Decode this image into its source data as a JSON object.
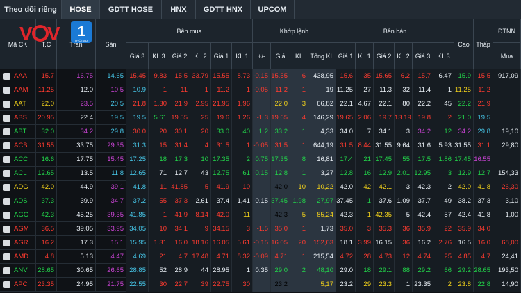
{
  "tabs": [
    "Theo dõi riêng",
    "HOSE",
    "GDTT HOSE",
    "HNX",
    "GDTT HNX",
    "UPCOM"
  ],
  "active_tab": "HOSE",
  "logo": {
    "text": "VOV",
    "badge": "1",
    "badge_sub": "THỜI SỰ"
  },
  "header": {
    "ma_ck": "Mã CK",
    "tc": "T.C",
    "tran": "Trần",
    "san": "Sàn",
    "ben_mua": "Bên mua",
    "khop_lenh": "Khớp lệnh",
    "ben_ban": "Bên bán",
    "cao": "Cao",
    "thap": "Thấp",
    "dtnn": "ĐTNN",
    "mua": "Mua",
    "gia3": "Giá 3",
    "kl3": "KL 3",
    "gia2": "Giá 2",
    "kl2": "KL 2",
    "gia1": "Giá 1",
    "kl1": "KL 1",
    "plusminus": "+/-",
    "gia": "Giá",
    "kl": "KL",
    "tong_kl": "Tổng KL"
  },
  "rows": [
    [
      "AAA",
      "15.7",
      "16.75",
      "14.65",
      "15.45",
      "9.83",
      "15.5",
      "33.79",
      "15.55",
      "8.73",
      "-0.15",
      "15.55",
      "6",
      "438,95",
      "15.6",
      "35",
      "15.65",
      "6.2",
      "15.7",
      "6.47",
      "15.9",
      "15.5",
      "917,09"
    ],
    [
      "AAM",
      "11.25",
      "12.0",
      "10.5",
      "10.9",
      "1",
      "11",
      "1",
      "11.2",
      "1",
      "-0.05",
      "11.2",
      "1",
      "19",
      "11.25",
      "27",
      "11.3",
      "32",
      "11.4",
      "1",
      "11.25",
      "11.2",
      ""
    ],
    [
      "AAT",
      "22.0",
      "23.5",
      "20.5",
      "21.8",
      "1.30",
      "21.9",
      "2.95",
      "21.95",
      "1.96",
      "",
      "22.0",
      "3",
      "66,82",
      "22.1",
      "4.67",
      "22.1",
      "80",
      "22.2",
      "45",
      "22.2",
      "21.9",
      ""
    ],
    [
      "ABS",
      "20.95",
      "22.4",
      "19.5",
      "19.5",
      "5.61",
      "19.55",
      "25",
      "19.6",
      "1.26",
      "-1.3",
      "19.65",
      "4",
      "146,29",
      "19.65",
      "2.06",
      "19.7",
      "13.19",
      "19.8",
      "2",
      "21.0",
      "19.5",
      ""
    ],
    [
      "ABT",
      "32.0",
      "34.2",
      "29.8",
      "30.0",
      "20",
      "30.1",
      "20",
      "33.0",
      "40",
      "1.2",
      "33.2",
      "1",
      "4,33",
      "34.0",
      "7",
      "34.1",
      "3",
      "34.2",
      "12",
      "34.2",
      "29.8",
      "19,10"
    ],
    [
      "ACB",
      "31.55",
      "33.75",
      "29.35",
      "31.3",
      "15",
      "31.4",
      "4",
      "31.5",
      "1",
      "-0.05",
      "31.5",
      "1",
      "644,19",
      "31.5",
      "8.44",
      "31.55",
      "9.64",
      "31.6",
      "5.93",
      "31.55",
      "31.1",
      "29,80"
    ],
    [
      "ACC",
      "16.6",
      "17.75",
      "15.45",
      "17.25",
      "18",
      "17.3",
      "10",
      "17.35",
      "2",
      "0.75",
      "17.35",
      "8",
      "16,81",
      "17.4",
      "21",
      "17.45",
      "55",
      "17.5",
      "1.86",
      "17.45",
      "16.55",
      ""
    ],
    [
      "ACL",
      "12.65",
      "13.5",
      "11.8",
      "12.65",
      "71",
      "12.7",
      "43",
      "12.75",
      "61",
      "0.15",
      "12.8",
      "1",
      "3,27",
      "12.8",
      "16",
      "12.9",
      "2.01",
      "12.95",
      "3",
      "12.9",
      "12.7",
      "154,33"
    ],
    [
      "ADG",
      "42.0",
      "44.9",
      "39.1",
      "41.8",
      "11",
      "41.85",
      "5",
      "41.9",
      "10",
      "",
      "42.0",
      "10",
      "10,22",
      "42.0",
      "42",
      "42.1",
      "3",
      "42.3",
      "2",
      "42.0",
      "41.8",
      "26,30"
    ],
    [
      "ADS",
      "37.3",
      "39.9",
      "34.7",
      "37.2",
      "55",
      "37.3",
      "2,61",
      "37.4",
      "1,41",
      "0.15",
      "37.45",
      "1.98",
      "27,97",
      "37.45",
      "1",
      "37.6",
      "1.09",
      "37.7",
      "49",
      "38.2",
      "37.3",
      "3,10"
    ],
    [
      "AGG",
      "42.3",
      "45.25",
      "39.35",
      "41.85",
      "1",
      "41.9",
      "8.14",
      "42.0",
      "11",
      "",
      "42.3",
      "5",
      "85,24",
      "42.3",
      "1",
      "42.35",
      "5",
      "42.4",
      "57",
      "42.4",
      "41.8",
      "1,00"
    ],
    [
      "AGM",
      "36.5",
      "39.05",
      "33.95",
      "34.05",
      "10",
      "34.1",
      "9",
      "34.15",
      "3",
      "-1.5",
      "35.0",
      "1",
      "1,73",
      "35.0",
      "3",
      "35.3",
      "36",
      "35.9",
      "22",
      "35.9",
      "34.0",
      ""
    ],
    [
      "AGR",
      "16.2",
      "17.3",
      "15.1",
      "15.95",
      "1.31",
      "16.0",
      "18.16",
      "16.05",
      "5.61",
      "-0.15",
      "16.05",
      "20",
      "152,63",
      "18.1",
      "3.99",
      "16.15",
      "36",
      "16.2",
      "2.76",
      "16.5",
      "16.0",
      "68,00"
    ],
    [
      "AMD",
      "4.8",
      "5.13",
      "4.47",
      "4.69",
      "21",
      "4.7",
      "17.48",
      "4.71",
      "8.32",
      "-0.09",
      "4.71",
      "1",
      "215,54",
      "4.72",
      "28",
      "4.73",
      "12",
      "4.74",
      "25",
      "4.85",
      "4.7",
      "24,41"
    ],
    [
      "ANV",
      "28.65",
      "30.65",
      "26.65",
      "28.85",
      "52",
      "28.9",
      "44",
      "28.95",
      "1",
      "0.35",
      "29.0",
      "2",
      "48,10",
      "29.0",
      "18",
      "29.1",
      "88",
      "29.2",
      "66",
      "29.2",
      "28.65",
      "193,50"
    ],
    [
      "APC",
      "23.35",
      "24.95",
      "21.75",
      "22.55",
      "30",
      "22.7",
      "39",
      "22.75",
      "30",
      "",
      "23.2",
      "",
      "5,17",
      "23.2",
      "29",
      "23.3",
      "1",
      "23.35",
      "2",
      "23.8",
      "22.8",
      "14,90"
    ]
  ],
  "row_colors": [
    [
      "r",
      "m",
      "b",
      "r",
      "r",
      "r",
      "r",
      "r",
      "r",
      "r",
      "r",
      "r",
      "w",
      "r",
      "r",
      "r",
      "r",
      "r",
      "w",
      "g",
      "r",
      "w"
    ],
    [
      "r",
      "w",
      "m",
      "b",
      "r",
      "r",
      "r",
      "r",
      "r",
      "r",
      "r",
      "r",
      "w",
      "w",
      "w",
      "w",
      "w",
      "w",
      "w",
      "y",
      "r",
      "w"
    ],
    [
      "y",
      "m",
      "b",
      "r",
      "r",
      "r",
      "r",
      "r",
      "r",
      "",
      "y",
      "y",
      "w",
      "w",
      "w",
      "w",
      "w",
      "w",
      "w",
      "g",
      "r",
      "w"
    ],
    [
      "r",
      "w",
      "b",
      "b",
      "g",
      "r",
      "r",
      "r",
      "r",
      "r",
      "r",
      "r",
      "w",
      "r",
      "r",
      "r",
      "r",
      "r",
      "r",
      "g",
      "b",
      "w"
    ],
    [
      "g",
      "m",
      "b",
      "r",
      "r",
      "r",
      "r",
      "g",
      "g",
      "g",
      "g",
      "g",
      "w",
      "w",
      "w",
      "w",
      "w",
      "m",
      "g",
      "m",
      "b",
      "w"
    ],
    [
      "r",
      "w",
      "m",
      "b",
      "r",
      "r",
      "r",
      "r",
      "r",
      "r",
      "r",
      "r",
      "w",
      "r",
      "r",
      "w",
      "w",
      "w",
      "w",
      "w",
      "r",
      "w"
    ],
    [
      "g",
      "w",
      "m",
      "b",
      "g",
      "g",
      "g",
      "g",
      "g",
      "g",
      "g",
      "g",
      "w",
      "g",
      "g",
      "g",
      "g",
      "g",
      "g",
      "g",
      "m",
      "w"
    ],
    [
      "g",
      "w",
      "b",
      "b",
      "w",
      "w",
      "w",
      "g",
      "g",
      "g",
      "g",
      "g",
      "w",
      "g",
      "g",
      "g",
      "g",
      "g",
      "g",
      "g",
      "g",
      "w"
    ],
    [
      "y",
      "w",
      "m",
      "b",
      "r",
      "r",
      "r",
      "r",
      "r",
      "r",
      "",
      "y",
      "y",
      "w",
      "y",
      "y",
      "w",
      "w",
      "w",
      "y",
      "y",
      "r"
    ],
    [
      "g",
      "w",
      "m",
      "b",
      "r",
      "r",
      "w",
      "w",
      "w",
      "w",
      "g",
      "g",
      "g",
      "w",
      "g",
      "w",
      "w",
      "w",
      "w",
      "w",
      "w",
      "w"
    ],
    [
      "g",
      "w",
      "m",
      "b",
      "r",
      "r",
      "r",
      "r",
      "y",
      "y",
      "",
      "y",
      "y",
      "w",
      "y",
      "y",
      "w",
      "w",
      "w",
      "w",
      "w",
      "w"
    ],
    [
      "r",
      "w",
      "m",
      "b",
      "r",
      "r",
      "r",
      "r",
      "r",
      "r",
      "r",
      "r",
      "w",
      "r",
      "r",
      "r",
      "r",
      "r",
      "r",
      "r",
      "r",
      "w"
    ],
    [
      "r",
      "w",
      "m",
      "b",
      "r",
      "r",
      "r",
      "r",
      "r",
      "r",
      "r",
      "r",
      "r",
      "w",
      "r",
      "w",
      "r",
      "w",
      "r",
      "w",
      "r",
      "r"
    ],
    [
      "r",
      "w",
      "m",
      "b",
      "r",
      "r",
      "r",
      "r",
      "r",
      "r",
      "r",
      "r",
      "w",
      "r",
      "r",
      "r",
      "r",
      "r",
      "r",
      "r",
      "r",
      "w"
    ],
    [
      "g",
      "w",
      "m",
      "b",
      "w",
      "w",
      "w",
      "w",
      "w",
      "w",
      "g",
      "g",
      "g",
      "w",
      "g",
      "g",
      "g",
      "g",
      "g",
      "g",
      "g",
      "w"
    ],
    [
      "r",
      "w",
      "m",
      "b",
      "r",
      "r",
      "r",
      "r",
      "r",
      "r",
      "",
      "y",
      "y",
      "w",
      "y",
      "y",
      "w",
      "w",
      "y",
      "y",
      "g",
      "w"
    ]
  ],
  "colors": {
    "up": "#22d44a",
    "down": "#ff3b30",
    "ref": "#f3d21b",
    "ceil": "#cc44d6",
    "floor": "#46c6e8"
  }
}
